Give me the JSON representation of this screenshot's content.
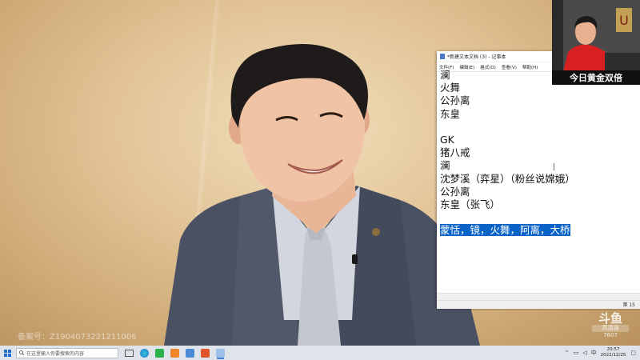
{
  "notepad": {
    "title": "*新建文本文档 (3) - 记事本",
    "menu": [
      "文件(F)",
      "编辑(E)",
      "格式(O)",
      "查看(V)",
      "帮助(H)"
    ],
    "lines": [
      "澜",
      "火舞",
      "公孙离",
      "东皇",
      "",
      "GK",
      "猪八戒",
      "澜",
      "沈梦溪（弈星）（粉丝说嫦娥）",
      "公孙离",
      "东皇（张飞）",
      "",
      "蒙恬，镜，火舞，阿离，大桥"
    ],
    "selected_line": "蒙恬，镜，火舞，阿离，大桥",
    "status": "第 15"
  },
  "webcam": {
    "banner": "今日黄金双倍"
  },
  "watermark": "备案号：Z1904073221211006",
  "logo": {
    "name": "斗鱼",
    "badge": "高清源",
    "room": "7607"
  },
  "taskbar": {
    "search_placeholder": "在这里输入你要搜索的内容",
    "pinned": [
      "task-view",
      "edge",
      "wechat",
      "app-orange",
      "weather",
      "app-red",
      "notepad"
    ],
    "tray_lang": "中",
    "time": "20:57",
    "date": "2022/12/25"
  },
  "colors": {
    "selection": "#0a64c8",
    "taskbar": "#dfe3ea",
    "wall": "#e2c497"
  }
}
